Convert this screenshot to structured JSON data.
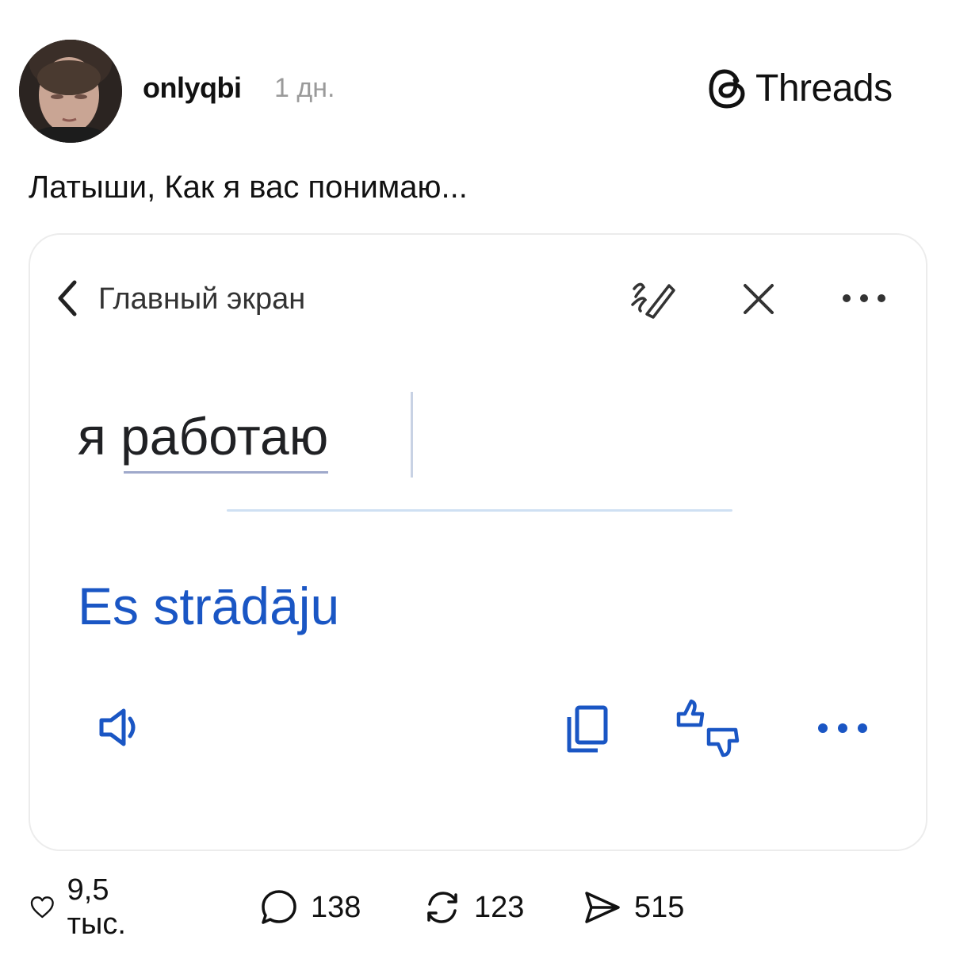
{
  "post": {
    "username": "onlyqbi",
    "time": "1 дн.",
    "caption": "Латыши, Как я вас понимаю..."
  },
  "brand": {
    "name": "Threads",
    "icon": "threads-logo-icon"
  },
  "card": {
    "back_label": "Главный экран",
    "source_prefix": "я ",
    "source_word": "работаю",
    "translation": "Es strādāju",
    "accent_color": "#1a56c4",
    "icons": [
      "back-chevron-icon",
      "handwriting-pen-icon",
      "close-icon",
      "more-horizontal-icon",
      "speaker-icon",
      "copy-icon",
      "thumbs-rate-icon",
      "more-horizontal-icon"
    ]
  },
  "actions": {
    "likes": "9,5 тыс.",
    "replies": "138",
    "reposts": "123",
    "shares": "515"
  }
}
